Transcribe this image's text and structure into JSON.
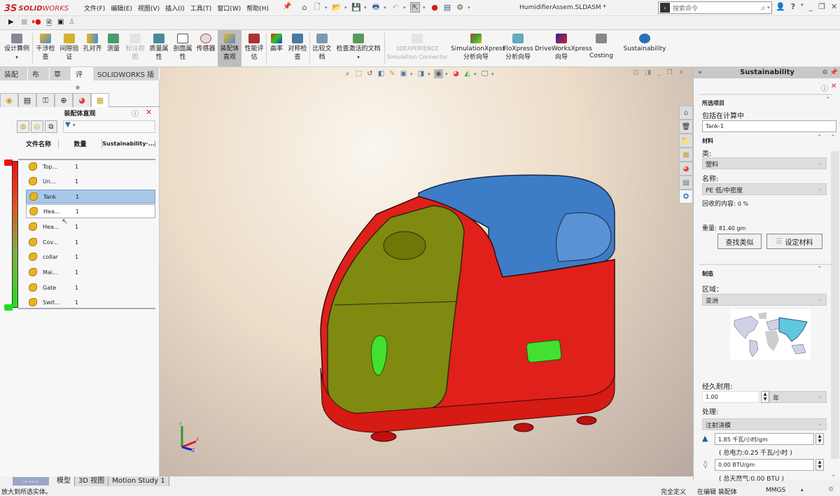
{
  "app": {
    "logo_ds": "3S",
    "logo_name_bold": "SOLID",
    "logo_name_light": "WORKS",
    "filename": "HumidifierAssem.SLDASM *"
  },
  "menu": [
    "文件(F)",
    "编辑(E)",
    "视图(V)",
    "插入(I)",
    "工具(T)",
    "窗口(W)",
    "帮助(H)"
  ],
  "search": {
    "placeholder": "搜索命令"
  },
  "command_manager": {
    "items": [
      {
        "label": "设计算例",
        "state": "normal"
      },
      {
        "label": "干涉检查",
        "state": "normal"
      },
      {
        "label": "间隙验证",
        "state": "normal"
      },
      {
        "label": "孔对齐",
        "state": "normal"
      },
      {
        "label": "测量",
        "state": "normal"
      },
      {
        "label": "标注视图",
        "state": "disabled"
      },
      {
        "label": "质量属性",
        "state": "normal"
      },
      {
        "label": "剖面属性",
        "state": "normal"
      },
      {
        "label": "传感器",
        "state": "normal"
      },
      {
        "label": "装配体直观",
        "state": "active"
      },
      {
        "label": "性能评估",
        "state": "normal"
      },
      {
        "label": "曲率",
        "state": "normal"
      },
      {
        "label": "对称检查",
        "state": "normal"
      },
      {
        "label": "比较文档",
        "state": "normal"
      },
      {
        "label": "检查激活的文档",
        "state": "normal"
      },
      {
        "label": "3DEXPERIENCE Simulation Connector",
        "state": "disabled"
      },
      {
        "label": "SimulationXpress 分析向导",
        "state": "normal"
      },
      {
        "label": "FloXpress 分析向导",
        "state": "normal"
      },
      {
        "label": "DriveWorksXpress 向导",
        "state": "normal"
      },
      {
        "label": "Costing",
        "state": "normal"
      },
      {
        "label": "Sustainability",
        "state": "normal"
      }
    ],
    "tabs": [
      {
        "label": "装配体",
        "active": false
      },
      {
        "label": "布局",
        "active": false
      },
      {
        "label": "草图",
        "active": false
      },
      {
        "label": "评估",
        "active": true
      },
      {
        "label": "SOLIDWORKS 插件",
        "active": false
      }
    ]
  },
  "assembly_visualization": {
    "title": "装配体直观",
    "columns": [
      "文件名称",
      "数量",
      "Sustainability·..."
    ],
    "rows": [
      {
        "name": "Top...",
        "qty": "1",
        "state": "normal"
      },
      {
        "name": "Un...",
        "qty": "1",
        "state": "normal"
      },
      {
        "name": "Tank",
        "qty": "1",
        "state": "selected"
      },
      {
        "name": "Hea...",
        "qty": "1",
        "state": "hover"
      },
      {
        "name": "Hea...",
        "qty": "1",
        "state": "normal"
      },
      {
        "name": "Cov...",
        "qty": "1",
        "state": "normal"
      },
      {
        "name": "collar",
        "qty": "1",
        "state": "normal"
      },
      {
        "name": "Mai...",
        "qty": "1",
        "state": "normal"
      },
      {
        "name": "Gate",
        "qty": "1",
        "state": "normal"
      },
      {
        "name": "Swit...",
        "qty": "1",
        "state": "normal"
      }
    ],
    "scale_colors": {
      "high": "#e01010",
      "low": "#22dd22"
    }
  },
  "sustainability": {
    "title": "Sustainability",
    "selected_section": "所选项目",
    "include_label": "包括在计算中",
    "selected_item": "Tank-1",
    "material_section": "材料",
    "class_label": "类:",
    "class_value": "塑料",
    "name_label": "名称:",
    "name_value": "PE 低/中密度",
    "recycled_label": "回收的内容:",
    "recycled_value": "0 %",
    "weight_label": "重量:",
    "weight_value": "81.40 gm",
    "find_similar": "查找类似",
    "set_material": "设定材料",
    "manufacturing_section": "制造",
    "region_label": "区域：",
    "region_value": "亚洲",
    "life_label": "经久耐用:",
    "life_value": "1.00",
    "life_unit": "年",
    "process_label": "处理:",
    "process_value": "注射浇模",
    "electricity_value": "1.85 千瓦/小时/gm",
    "electricity_total": "( 总电力:0.25 千瓦/小时 )",
    "gas_value": "0.00 BTU/gm",
    "gas_total": "( 总天然气:0.00 BTU )"
  },
  "bottom_tabs": [
    {
      "label": "模型",
      "active": true
    },
    {
      "label": "3D 视图",
      "active": false
    },
    {
      "label": "Motion Study 1",
      "active": false
    }
  ],
  "status": {
    "message": "放大到所选实体。",
    "definition": "完全定义",
    "editing": "在编辑 装配体",
    "units": "MMGS"
  }
}
